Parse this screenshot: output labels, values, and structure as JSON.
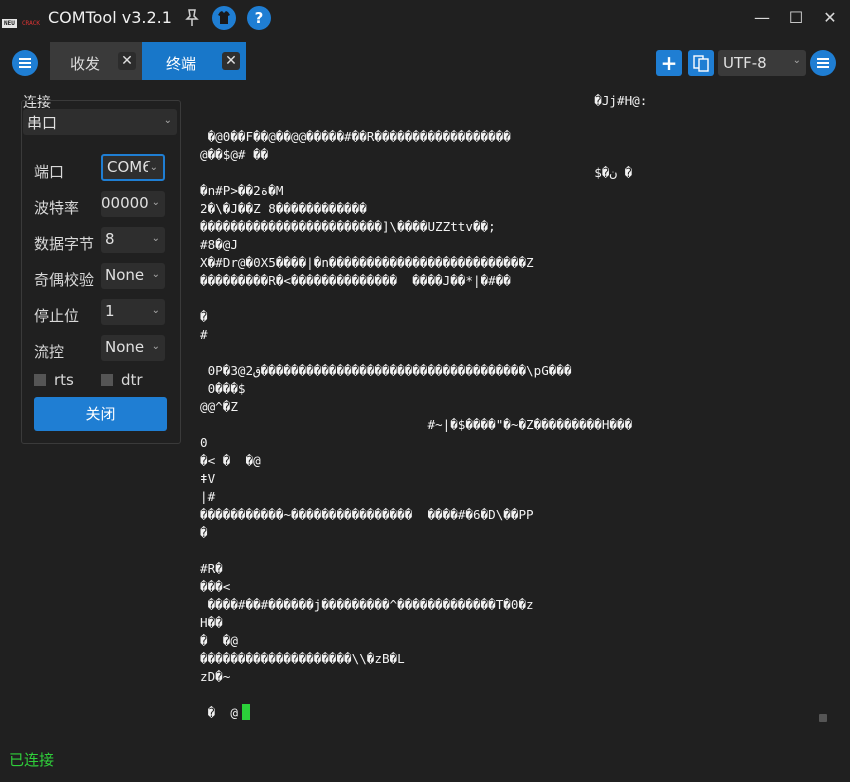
{
  "window": {
    "logo_top": "NEU",
    "logo_bottom": "CRACK",
    "title": "COMTool v3.2.1",
    "icons": [
      "pin-icon",
      "shirt-icon",
      "help-icon"
    ],
    "help_glyph": "?",
    "controls": {
      "minimize": "—",
      "maximize": "☐",
      "close": "✕"
    }
  },
  "tabs": [
    {
      "label": "收发",
      "close": "✕",
      "active": false
    },
    {
      "label": "终端",
      "close": "✕",
      "active": true
    }
  ],
  "toolbar": {
    "add_glyph": "+",
    "encoding": "UTF-8",
    "dropdown_glyph": "⌄"
  },
  "connection": {
    "section_label": "连接",
    "type": "串口",
    "fields": [
      {
        "label": "端口",
        "value": "COM6"
      },
      {
        "label": "波特率",
        "value": "00000"
      },
      {
        "label": "数据字节",
        "value": "8"
      },
      {
        "label": "奇偶校验",
        "value": "None"
      },
      {
        "label": "停止位",
        "value": "1"
      },
      {
        "label": "流控",
        "value": "None"
      }
    ],
    "rts_label": "rts",
    "dtr_label": "dtr",
    "close_label": "关闭"
  },
  "terminal": {
    "lines": [
      "                                                    �Jj#H@:",
      "",
      " �@0��F��@��@@�����#��R������������������",
      "@��$@# ��",
      "                                                    $�ن �",
      "�n#P>��2ة�M",
      "2�\\�J��Z 8������������",
      "������������������������]\\����UZZttv��;",
      "#8�@J",
      "X�#Dr@�0X5����|�n��������������������������Z",
      "���������R�<��������������  ����J��*|�#��",
      "",
      "�",
      "#",
      "",
      " 0P�3@2ق�����������������������������������\\pG���",
      " 0���$",
      "@@^�Z",
      "                              #~|�$����\"�~�Z���������H���",
      "0",
      "�< �  �@",
      "ǂV",
      "|#",
      "�����������~����������������  ����#�6�D\\��PP",
      "�",
      "",
      "#R�",
      "���<",
      " ����#��#������j���������^�������������T�0�z",
      "H��",
      "�  �@",
      "��������������������\\\\�zB�L",
      "zD�~",
      ""
    ],
    "prompt": " �  @"
  },
  "status": "已连接",
  "colors": {
    "accent": "#1f7ed3",
    "background": "#202020",
    "status_ok": "#2fcf3a",
    "cursor": "#2bd23a"
  }
}
